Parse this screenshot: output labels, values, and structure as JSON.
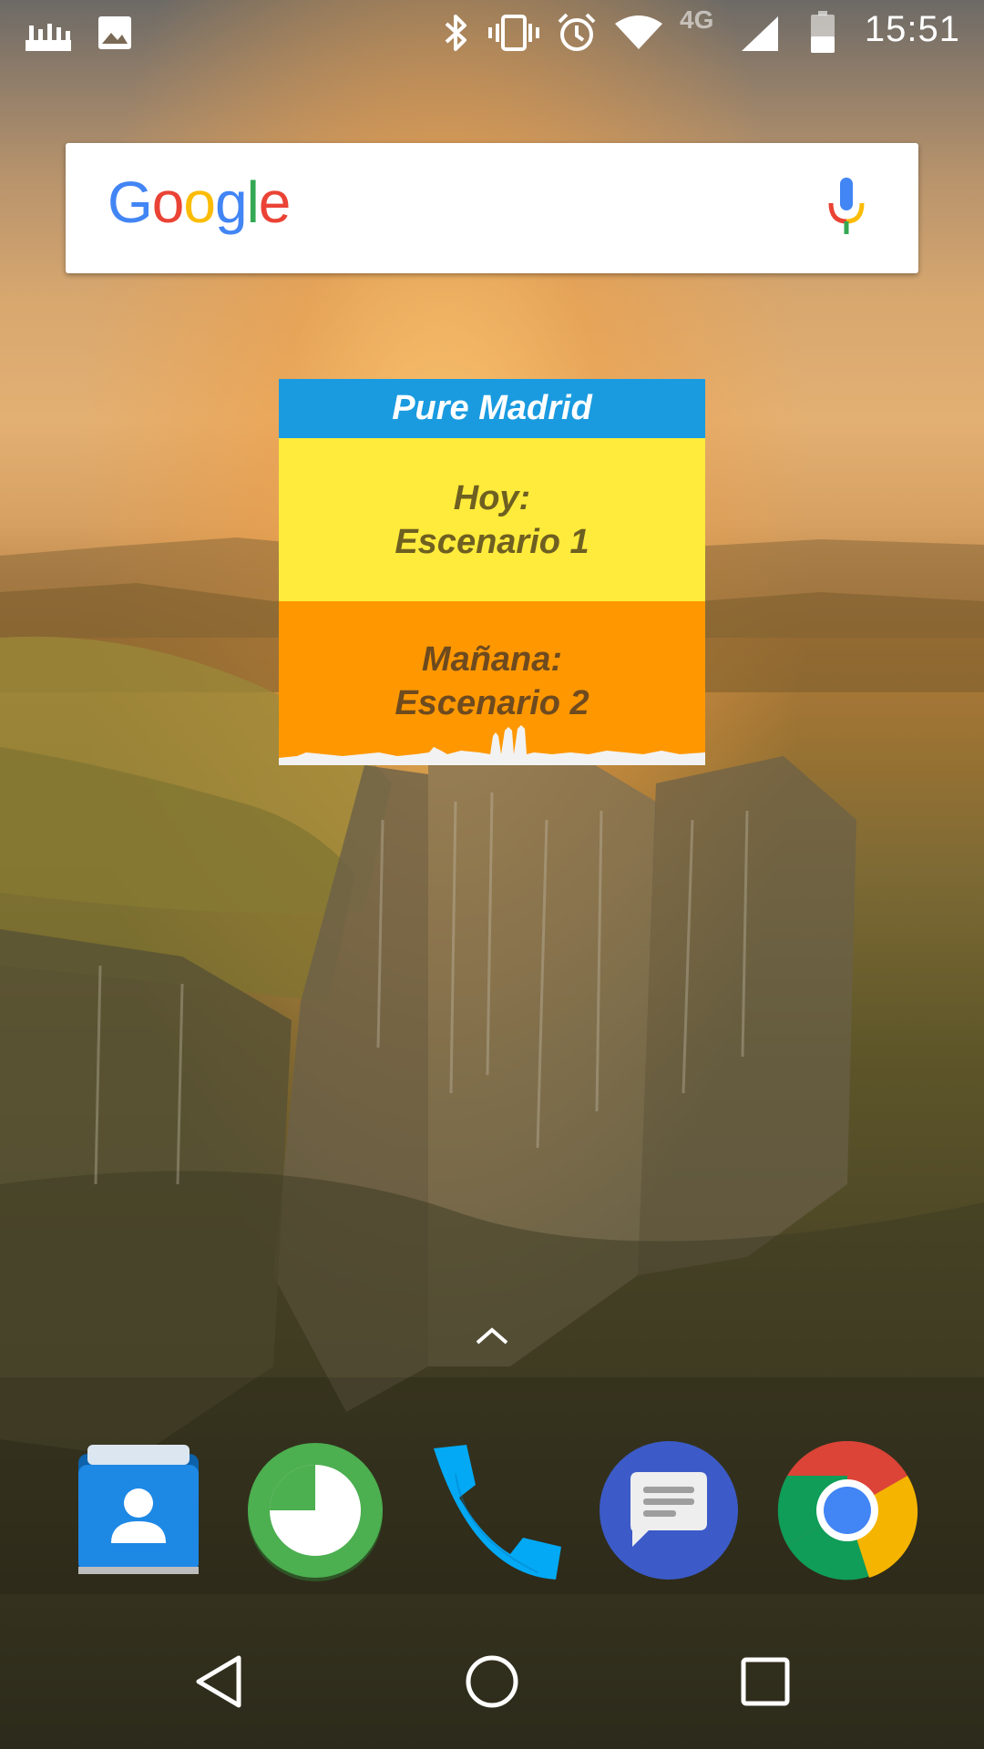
{
  "status_bar": {
    "time": "15:51",
    "network_type": "4G",
    "left_icons": [
      "signal-bars-notification-icon",
      "image-notification-icon"
    ],
    "right_icons": [
      "bluetooth-icon",
      "vibrate-icon",
      "alarm-icon",
      "wifi-icon",
      "cell-signal-icon",
      "battery-icon"
    ]
  },
  "search_widget": {
    "logo_text": "Google",
    "logo_colors": [
      "#4285F4",
      "#EA4335",
      "#FBBC05",
      "#4285F4",
      "#34A853",
      "#EA4335"
    ],
    "mic_icon": "mic-icon"
  },
  "madrid_widget": {
    "title": "Pure Madrid",
    "today_label": "Hoy:",
    "today_value": "Escenario 1",
    "tomorrow_label": "Mañana:",
    "tomorrow_value": "Escenario 2",
    "colors": {
      "header": "#1a9be0",
      "today": "#ffeb3b",
      "tomorrow": "#ff9800"
    }
  },
  "dock": {
    "apps": [
      {
        "name": "Contacts",
        "icon": "contacts-icon"
      },
      {
        "name": "Clock",
        "icon": "pie-clock-icon"
      },
      {
        "name": "Phone",
        "icon": "phone-icon"
      },
      {
        "name": "Messages",
        "icon": "messages-icon"
      },
      {
        "name": "Chrome",
        "icon": "chrome-icon"
      }
    ]
  },
  "nav_bar": {
    "buttons": [
      "back-icon",
      "home-icon",
      "recents-icon"
    ]
  }
}
